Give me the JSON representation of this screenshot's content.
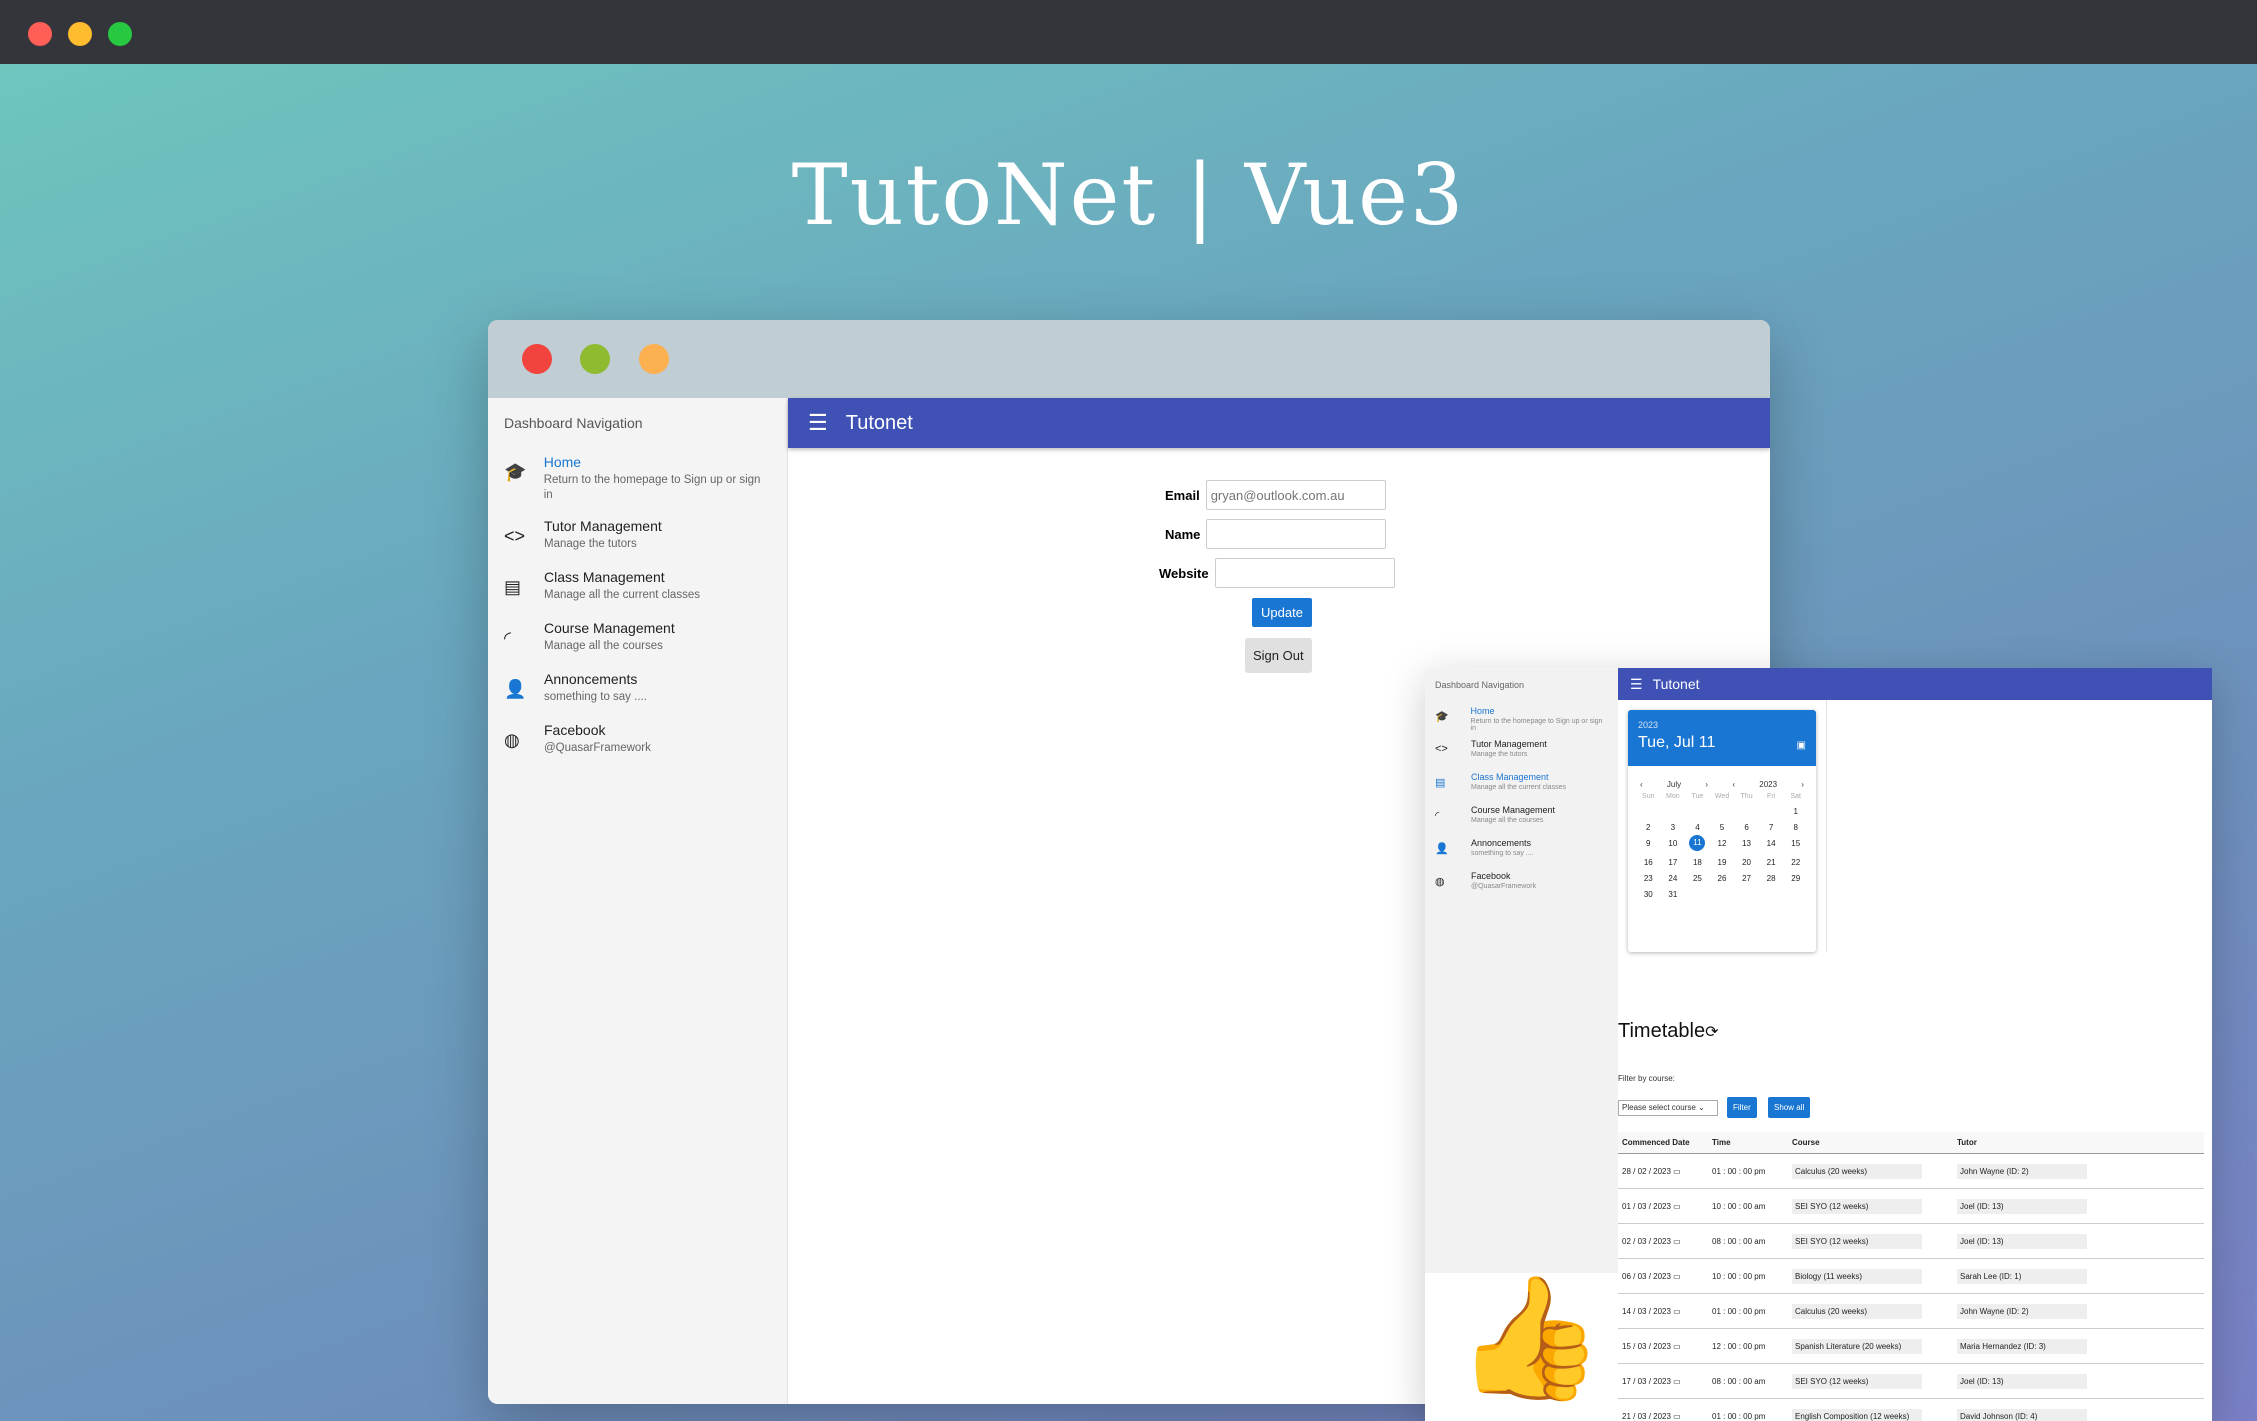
{
  "hero_title": "TutoNet | Vue3",
  "main_window": {
    "sidebar_header": "Dashboard Navigation",
    "nav_items": [
      {
        "title": "Home",
        "subtitle": "Return to the homepage to Sign up or sign in",
        "icon": "school-icon",
        "active": true
      },
      {
        "title": "Tutor Management",
        "subtitle": "Manage the tutors",
        "icon": "code-icon"
      },
      {
        "title": "Class Management",
        "subtitle": "Manage all the current classes",
        "icon": "chat-icon"
      },
      {
        "title": "Course Management",
        "subtitle": "Manage all the courses",
        "icon": "rss-icon"
      },
      {
        "title": "Annoncements",
        "subtitle": "something to say ....",
        "icon": "record-voice-icon"
      },
      {
        "title": "Facebook",
        "subtitle": "@QuasarFramework",
        "icon": "globe-icon"
      }
    ],
    "app_title": "Tutonet",
    "form": {
      "email_label": "Email",
      "email_value": "gryan@outlook.com.au",
      "name_label": "Name",
      "name_value": "",
      "website_label": "Website",
      "website_value": "",
      "update_label": "Update",
      "signout_label": "Sign Out"
    }
  },
  "second_window": {
    "sidebar_header": "Dashboard Navigation",
    "nav_items": [
      {
        "title": "Home",
        "subtitle": "Return to the homepage to Sign up or sign in",
        "active": true
      },
      {
        "title": "Tutor Management",
        "subtitle": "Manage the tutors"
      },
      {
        "title": "Class Management",
        "subtitle": "Manage all the current classes",
        "active": true
      },
      {
        "title": "Course Management",
        "subtitle": "Manage all the courses"
      },
      {
        "title": "Annoncements",
        "subtitle": "something to say ...."
      },
      {
        "title": "Facebook",
        "subtitle": "@QuasarFramework"
      }
    ],
    "app_title": "Tutonet",
    "calendar": {
      "year": "2023",
      "date_label": "Tue, Jul 11",
      "month": "July",
      "year_nav": "2023",
      "weekdays": [
        "Sun",
        "Mon",
        "Tue",
        "Wed",
        "Thu",
        "Fri",
        "Sat"
      ],
      "selected_day": "11"
    },
    "timetable_title": "Timetable",
    "filter_label": "Filter by course:",
    "select_placeholder": "Please select course",
    "filter_button": "Filter",
    "show_all_button": "Show all",
    "columns": [
      "Commenced Date",
      "Time",
      "Course",
      "Tutor"
    ],
    "rows": [
      {
        "date": "28 / 02 / 2023",
        "time": "01 : 00 : 00   pm",
        "course": "Calculus (20 weeks)",
        "tutor": "John Wayne (ID: 2)"
      },
      {
        "date": "01 / 03 / 2023",
        "time": "10 : 00 : 00   am",
        "course": "SEI SYO (12 weeks)",
        "tutor": "Joel (ID: 13)"
      },
      {
        "date": "02 / 03 / 2023",
        "time": "08 : 00 : 00   am",
        "course": "SEI SYO (12 weeks)",
        "tutor": "Joel (ID: 13)"
      },
      {
        "date": "06 / 03 / 2023",
        "time": "10 : 00 : 00   pm",
        "course": "Biology (11 weeks)",
        "tutor": "Sarah Lee (ID: 1)"
      },
      {
        "date": "14 / 03 / 2023",
        "time": "01 : 00 : 00   pm",
        "course": "Calculus (20 weeks)",
        "tutor": "John Wayne (ID: 2)"
      },
      {
        "date": "15 / 03 / 2023",
        "time": "12 : 00 : 00   pm",
        "course": "Spanish Literature (20 weeks)",
        "tutor": "Maria Hernandez (ID: 3)"
      },
      {
        "date": "17 / 03 / 2023",
        "time": "08 : 00 : 00   am",
        "course": "SEI SYO (12 weeks)",
        "tutor": "Joel (ID: 13)"
      },
      {
        "date": "21 / 03 / 2023",
        "time": "01 : 00 : 00   pm",
        "course": "English Composition (12 weeks)",
        "tutor": "David Johnson (ID: 4)"
      }
    ]
  }
}
